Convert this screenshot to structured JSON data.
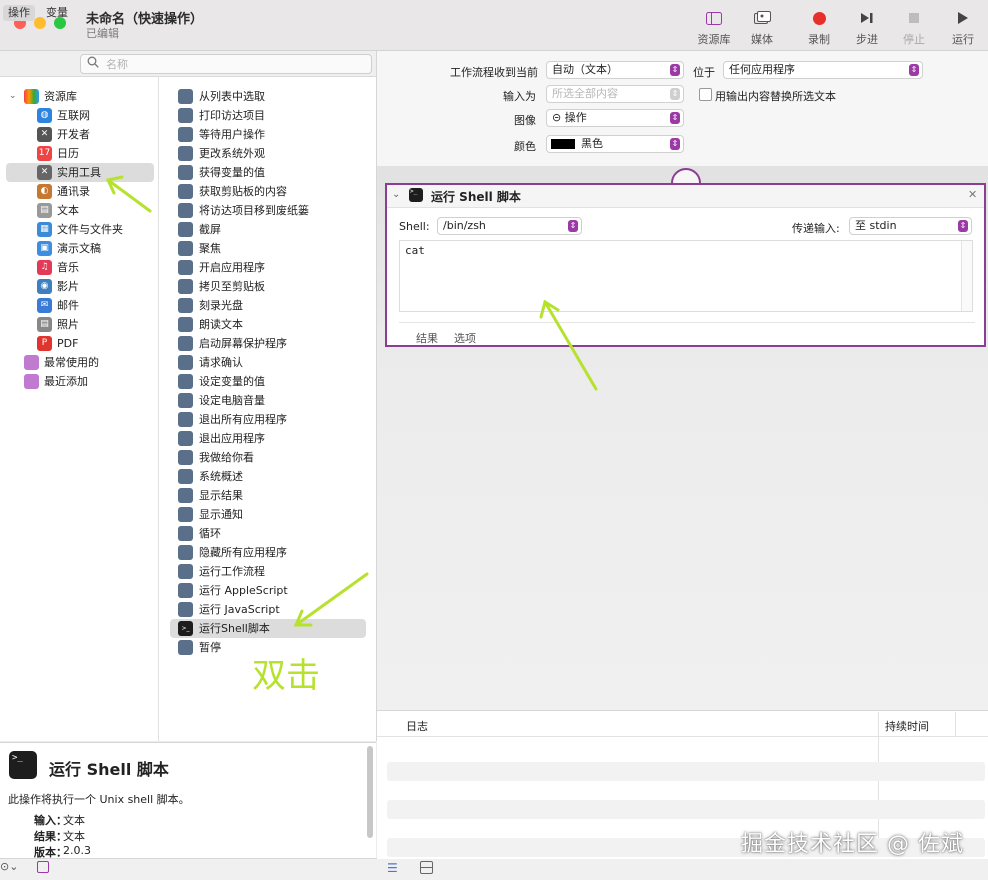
{
  "window": {
    "title": "未命名（快速操作）",
    "subtitle": "已编辑"
  },
  "toolbar": {
    "library": "资源库",
    "media": "媒体",
    "record": "录制",
    "step": "步进",
    "stop": "停止",
    "run": "运行"
  },
  "left": {
    "tabs": [
      "操作",
      "变量"
    ],
    "search_placeholder": "名称",
    "library_root": "资源库",
    "library_items": [
      "互联网",
      "开发者",
      "日历",
      "实用工具",
      "通讯录",
      "文本",
      "文件与文件夹",
      "演示文稿",
      "音乐",
      "影片",
      "邮件",
      "照片",
      "PDF"
    ],
    "extra_items": [
      "最常使用的",
      "最近添加"
    ],
    "actions": [
      "从列表中选取",
      "打印访达项目",
      "等待用户操作",
      "更改系统外观",
      "获得变量的值",
      "获取剪贴板的内容",
      "将访达项目移到废纸篓",
      "截屏",
      "聚焦",
      "开启应用程序",
      "拷贝至剪贴板",
      "刻录光盘",
      "朗读文本",
      "启动屏幕保护程序",
      "请求确认",
      "设定变量的值",
      "设定电脑音量",
      "退出所有应用程序",
      "退出应用程序",
      "我做给你看",
      "系统概述",
      "显示结果",
      "显示通知",
      "循环",
      "隐藏所有应用程序",
      "运行工作流程",
      "运行 AppleScript",
      "运行 JavaScript",
      "运行Shell脚本",
      "暂停"
    ],
    "selected_action": "运行Shell脚本"
  },
  "description": {
    "title": "运行 Shell 脚本",
    "text": "此操作将执行一个 Unix shell 脚本。",
    "input_label": "输入：",
    "input_value": "文本",
    "result_label": "结果：",
    "result_value": "文本",
    "version_label": "版本：",
    "version_value": "2.0.3"
  },
  "workflow_settings": {
    "receives_label": "工作流程收到当前",
    "receives_value": "自动（文本）",
    "in_label": "位于",
    "in_value": "任何应用程序",
    "input_label": "输入为",
    "input_value": "所选全部内容",
    "replace_label": "用输出内容替换所选文本",
    "image_label": "图像",
    "image_value": "⊝ 操作",
    "color_label": "颜色",
    "color_value": "黑色"
  },
  "action_box": {
    "title": "运行 Shell 脚本",
    "shell_label": "Shell:",
    "shell_value": "/bin/zsh",
    "pass_label": "传递输入:",
    "pass_value": "至 stdin",
    "code": "cat",
    "tab_results": "结果",
    "tab_options": "选项"
  },
  "log": {
    "col_log": "日志",
    "col_duration": "持续时间"
  },
  "annotation": {
    "text": "双击"
  },
  "watermark": "掘金技术社区 @ 佐斌",
  "colors": {
    "accent": "#9b3aa6",
    "record": "#e8302a",
    "annot": "#b6e22e"
  }
}
